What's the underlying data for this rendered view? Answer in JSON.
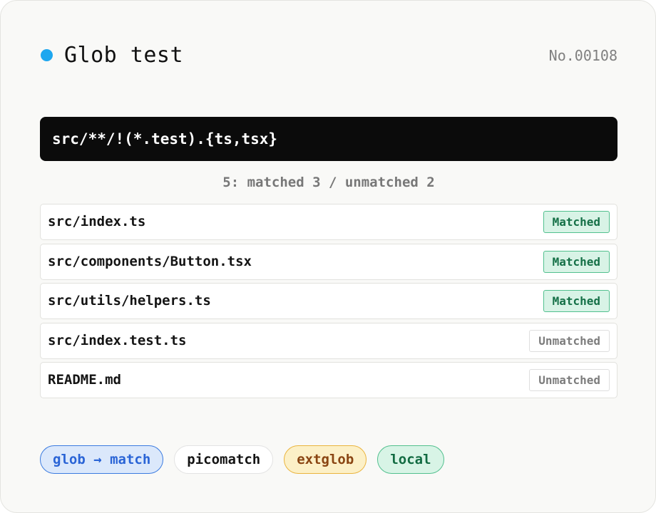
{
  "header": {
    "title": "Glob test",
    "number": "No.00108",
    "accent_color": "#1ea7ef"
  },
  "pattern": "src/**/!(*.test).{ts,tsx}",
  "summary": "5: matched 3 / unmatched 2",
  "results": [
    {
      "path": "src/index.ts",
      "status": "Matched"
    },
    {
      "path": "src/components/Button.tsx",
      "status": "Matched"
    },
    {
      "path": "src/utils/helpers.ts",
      "status": "Matched"
    },
    {
      "path": "src/index.test.ts",
      "status": "Unmatched"
    },
    {
      "path": "README.md",
      "status": "Unmatched"
    }
  ],
  "tags": [
    {
      "label": "glob → match",
      "color": "#2a64d6"
    },
    {
      "label": "picomatch",
      "color": "#141414"
    },
    {
      "label": "extglob",
      "color": "#8a4512"
    },
    {
      "label": "local",
      "color": "#126b42"
    }
  ]
}
